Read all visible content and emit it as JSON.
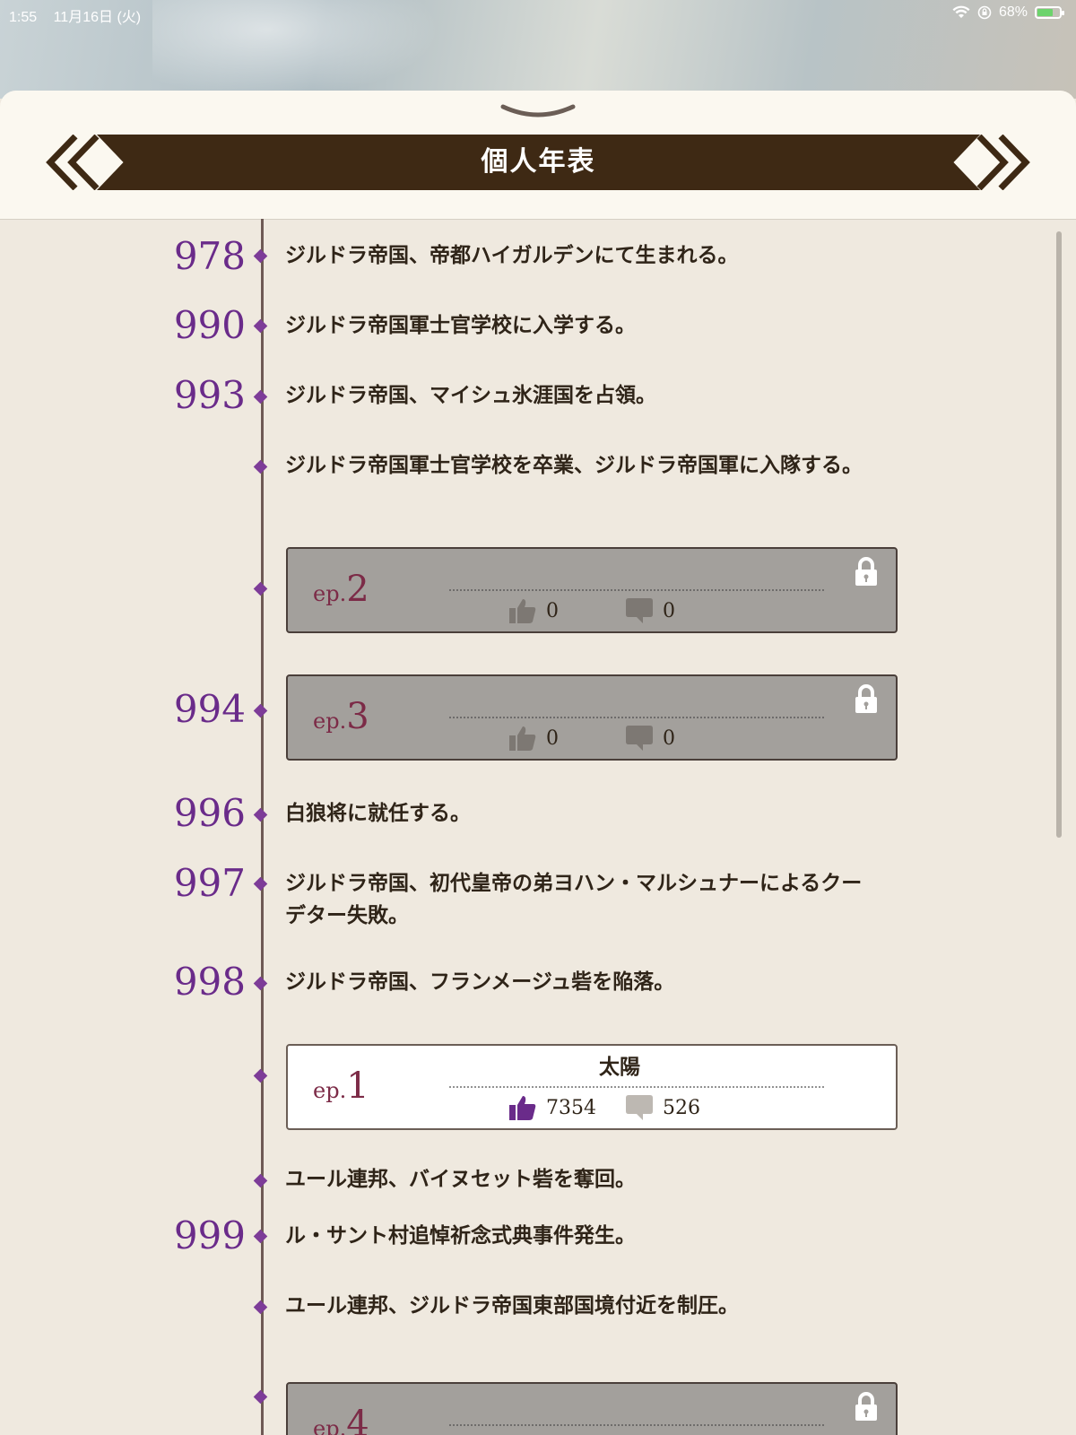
{
  "status_bar": {
    "time": "1:55",
    "date": "11月16日 (火)",
    "battery": "68%"
  },
  "header": {
    "title": "個人年表"
  },
  "colors": {
    "year": "#6a2b8a",
    "banner": "#3e2914",
    "locked_card": "#a3a09c",
    "episode_label": "#7c2b47",
    "like_icon_active": "#6a2b8a"
  },
  "timeline": [
    {
      "year": "978",
      "text": "ジルドラ帝国、帝都ハイガルデンにて生まれる。"
    },
    {
      "year": "990",
      "text": "ジルドラ帝国軍士官学校に入学する。"
    },
    {
      "year": "993",
      "text": "ジルドラ帝国、マイシュ氷涯国を占領。"
    },
    {
      "year": "",
      "text": "ジルドラ帝国軍士官学校を卒業、ジルドラ帝国軍に入隊する。"
    },
    {
      "type": "episode",
      "year": "",
      "ep_prefix": "ep.",
      "ep_num": "2",
      "title": "",
      "likes": "0",
      "comments": "0",
      "locked": true
    },
    {
      "type": "episode",
      "year": "994",
      "ep_prefix": "ep.",
      "ep_num": "3",
      "title": "",
      "likes": "0",
      "comments": "0",
      "locked": true
    },
    {
      "year": "996",
      "text": "白狼将に就任する。"
    },
    {
      "year": "997",
      "text": "ジルドラ帝国、初代皇帝の弟ヨハン・マルシュナーによるクーデター失敗。"
    },
    {
      "year": "998",
      "text": "ジルドラ帝国、フランメージュ砦を陥落。"
    },
    {
      "type": "episode",
      "year": "",
      "ep_prefix": "ep.",
      "ep_num": "1",
      "title": "太陽",
      "likes": "7354",
      "comments": "526",
      "locked": false
    },
    {
      "year": "",
      "text": "ユール連邦、バイヌセット砦を奪回。"
    },
    {
      "year": "999",
      "text": "ル・サント村追悼祈念式典事件発生。"
    },
    {
      "year": "",
      "text": "ユール連邦、ジルドラ帝国東部国境付近を制圧。"
    },
    {
      "type": "episode",
      "year": "",
      "ep_prefix": "ep.",
      "ep_num": "4",
      "title": "",
      "likes": "",
      "comments": "",
      "locked": true
    }
  ]
}
